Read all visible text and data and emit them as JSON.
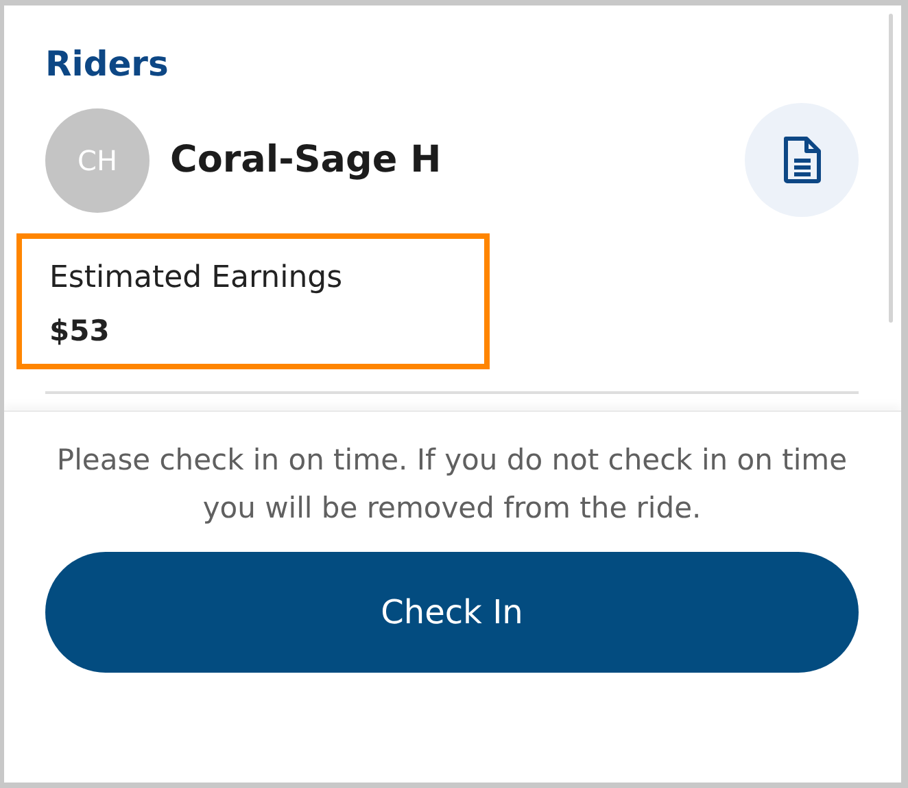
{
  "section_title": "Riders",
  "rider": {
    "initials": "CH",
    "name": "Coral-Sage H"
  },
  "earnings": {
    "label": "Estimated Earnings",
    "value": "$53",
    "highlighted": true
  },
  "notice": "Please check in on time. If you do not check in on time you will be removed from the ride.",
  "action_button": "Check In"
}
